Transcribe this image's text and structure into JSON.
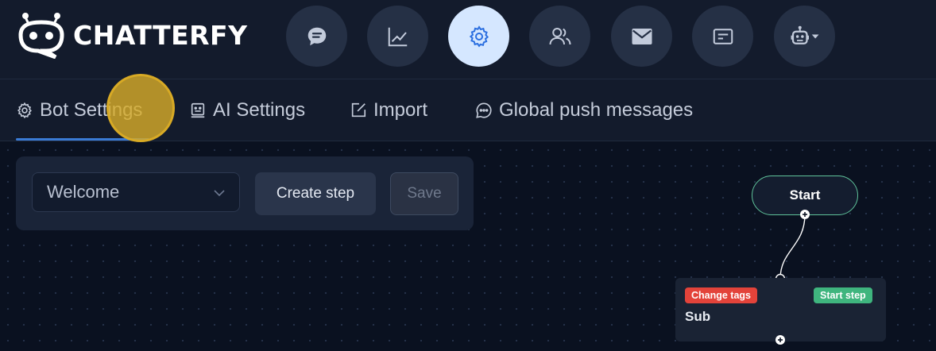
{
  "brand": {
    "name": "CHATTERFY"
  },
  "nav": {
    "items": [
      {
        "icon": "chat-bubble-icon",
        "active": false
      },
      {
        "icon": "analytics-chart-icon",
        "active": false
      },
      {
        "icon": "gear-icon",
        "active": true
      },
      {
        "icon": "users-icon",
        "active": false
      },
      {
        "icon": "mail-icon",
        "active": false
      },
      {
        "icon": "message-card-icon",
        "active": false
      },
      {
        "icon": "bot-dropdown-icon",
        "active": false
      }
    ]
  },
  "tabs": {
    "bot_settings": "Bot Settings",
    "ai_settings": "AI Settings",
    "import": "Import",
    "global_push": "Global push messages",
    "active": "Bot Settings"
  },
  "toolbar": {
    "flow_select_value": "Welcome",
    "create_step_label": "Create step",
    "save_label": "Save"
  },
  "flow": {
    "start_label": "Start",
    "sub_node": {
      "title": "Sub",
      "tag_left": "Change tags",
      "tag_right": "Start step"
    }
  },
  "colors": {
    "accent": "#3a7bd5",
    "active_nav_bg": "#d5e7ff",
    "tag_red": "#e3433a",
    "tag_green": "#3fb57e",
    "start_border": "#5fc29a"
  }
}
